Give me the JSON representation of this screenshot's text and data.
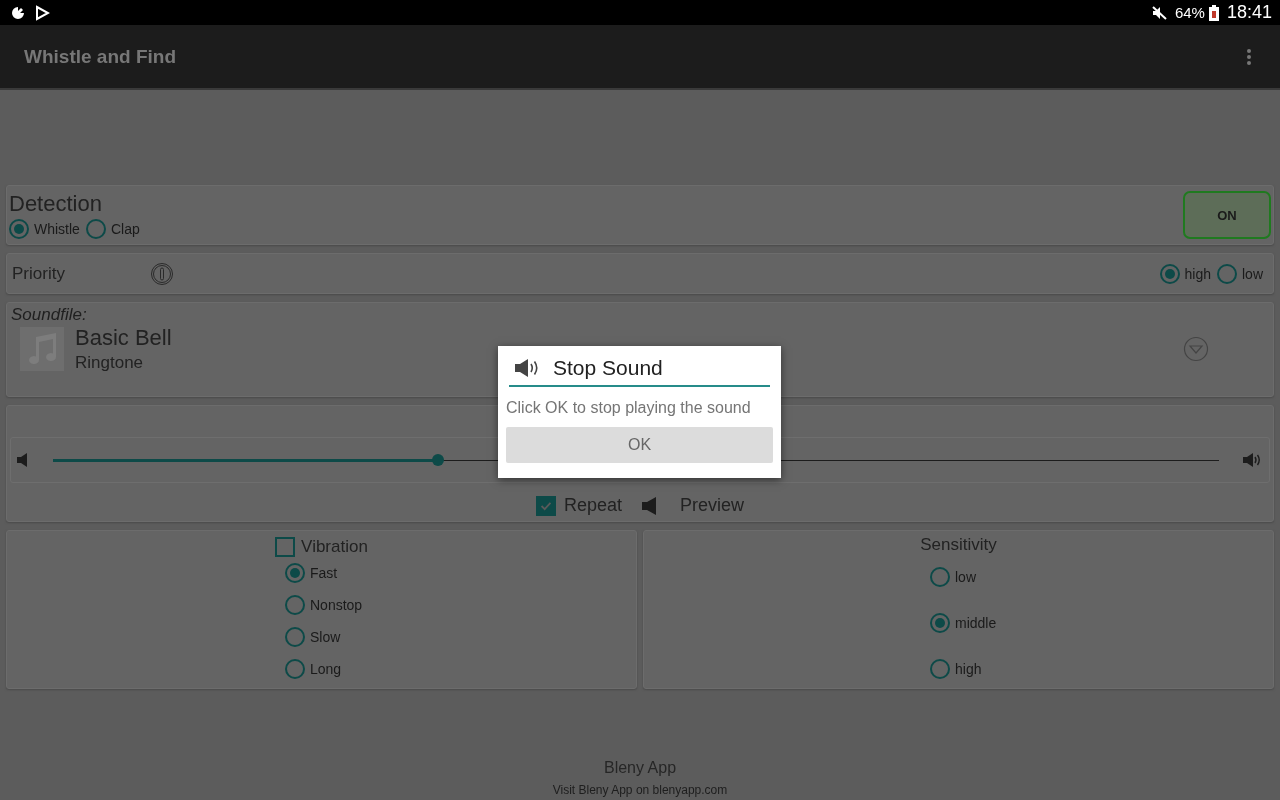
{
  "status_bar": {
    "battery": "64%",
    "time": "18:41"
  },
  "app_bar": {
    "title": "Whistle and Find"
  },
  "detection": {
    "title": "Detection",
    "options": [
      {
        "label": "Whistle",
        "selected": true
      },
      {
        "label": "Clap",
        "selected": false
      }
    ],
    "toggle": {
      "label": "ON",
      "on": true
    }
  },
  "priority": {
    "label": "Priority",
    "options": [
      {
        "label": "high",
        "selected": true
      },
      {
        "label": "low",
        "selected": false
      }
    ]
  },
  "soundfile": {
    "label": "Soundfile:",
    "name": "Basic Bell",
    "type": "Ringtone"
  },
  "volume": {
    "level": 0.33
  },
  "repeat": {
    "label": "Repeat",
    "checked": true
  },
  "preview": {
    "label": "Preview"
  },
  "vibration": {
    "label": "Vibration",
    "checked": false,
    "options": [
      {
        "label": "Fast",
        "selected": true
      },
      {
        "label": "Nonstop",
        "selected": false
      },
      {
        "label": "Slow",
        "selected": false
      },
      {
        "label": "Long",
        "selected": false
      }
    ]
  },
  "sensitivity": {
    "title": "Sensitivity",
    "options": [
      {
        "label": "low",
        "selected": false
      },
      {
        "label": "middle",
        "selected": true
      },
      {
        "label": "high",
        "selected": false
      }
    ]
  },
  "footer": {
    "title": "Bleny App",
    "link": "Visit Bleny App on blenyapp.com"
  },
  "dialog": {
    "title": "Stop Sound",
    "message": "Click OK to stop playing the sound",
    "button": "OK"
  }
}
